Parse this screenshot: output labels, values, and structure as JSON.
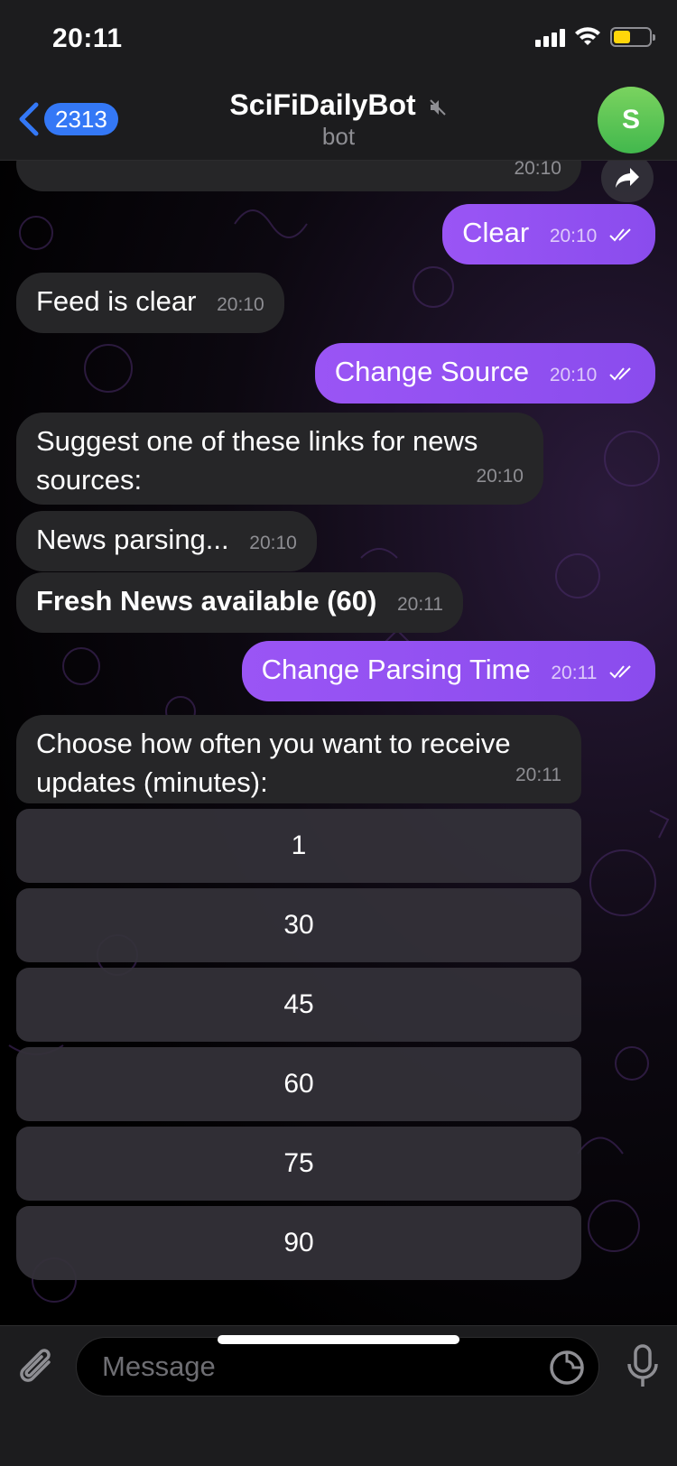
{
  "status_bar": {
    "time": "20:11"
  },
  "header": {
    "back_count": "2313",
    "title": "SciFiDailyBot",
    "subtitle": "bot",
    "avatar_letter": "S"
  },
  "messages": [
    {
      "side": "in",
      "text": "",
      "time": "20:10"
    },
    {
      "side": "out",
      "text": "Clear",
      "time": "20:10"
    },
    {
      "side": "in",
      "text": "Feed is clear",
      "time": "20:10"
    },
    {
      "side": "out",
      "text": "Change Source",
      "time": "20:10"
    },
    {
      "side": "in",
      "text": "Suggest one of these links for news sources:",
      "time": "20:10"
    },
    {
      "side": "in",
      "text": "News parsing...",
      "time": "20:10"
    },
    {
      "side": "in",
      "text": "Fresh News available (60)",
      "time": "20:11",
      "bold": true
    },
    {
      "side": "out",
      "text": "Change Parsing Time",
      "time": "20:11"
    },
    {
      "side": "in",
      "text": "Choose how often you want to receive updates (minutes):",
      "time": "20:11"
    }
  ],
  "keyboard": [
    "1",
    "30",
    "45",
    "60",
    "75",
    "90"
  ],
  "input": {
    "placeholder": "Message"
  },
  "colors": {
    "accent": "#3478f6",
    "outgoing": "#8d4ff0",
    "incoming": "#262628"
  }
}
